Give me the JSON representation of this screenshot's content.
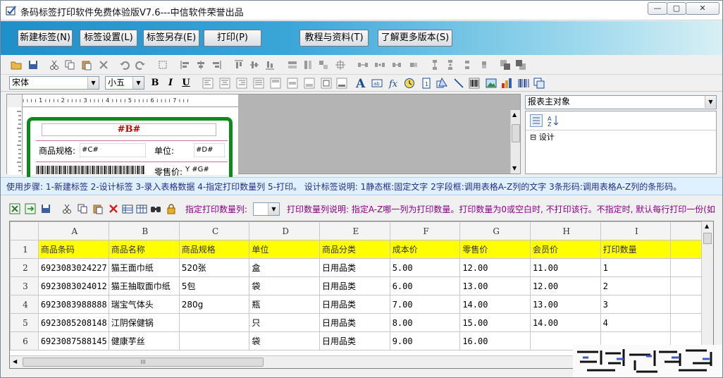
{
  "window": {
    "title": "条码标签打印软件免费体验版V7.6---中信软件荣誉出品",
    "buttons": {
      "minimize": "—",
      "restore": "▢",
      "close": "✕"
    }
  },
  "banner": {
    "buttons": [
      "新建标签(N)",
      "标签设置(L)",
      "标签另存(E)",
      "打印(P)",
      "教程与资料(T)",
      "了解更多版本(S)"
    ]
  },
  "format_bar": {
    "font_name": "宋体",
    "font_size": "小五",
    "bold": "B",
    "italic": "I",
    "underline": "U"
  },
  "designer": {
    "ruler_top": "ı ı ı ı 1 ı ı ı ı 2 ı ı ı ı 3 ı ı ı ı 4 ı ı ı ı 5 ı ı ı ı 6 ı ı ı ı 7 ı ı ı",
    "label": {
      "field_b": "#B#",
      "spec_label": "商品规格:",
      "spec_field": "#C#",
      "unit_label": "单位:",
      "unit_field": "#D#",
      "price_label": "零售价:",
      "price_field": "Y #G#"
    }
  },
  "properties": {
    "object_select": "报表主对象",
    "group_label": "设计"
  },
  "hint": "使用步骤: 1-新建标签 2-设计标签 3-录入表格数据 4-指定打印数量列 5-打印。 设计标签说明: 1静态框:固定文字 2字段框:调用表格A-Z列的文字 3条形码:调用表格A-Z列的条形码。",
  "data_toolbar": {
    "print_qty_label": "指定打印数量列:",
    "print_qty_value": "",
    "explain": "打印数量列说明: 指定A-Z哪一列为打印数量。打印数量为0或空白时, 不打印该行。不指定时, 默认每行打印一份(如"
  },
  "sheet": {
    "columns": [
      "A",
      "B",
      "C",
      "D",
      "E",
      "F",
      "G",
      "H",
      "I"
    ],
    "rows": [
      {
        "n": "1",
        "cells": [
          "商品条码",
          "商品名称",
          "商品规格",
          "单位",
          "商品分类",
          "成本价",
          "零售价",
          "会员价",
          "打印数量"
        ]
      },
      {
        "n": "2",
        "cells": [
          "6923083024227",
          "猫王面巾纸",
          "520张",
          "盒",
          "日用品类",
          "5.00",
          "12.00",
          "11.00",
          "1"
        ]
      },
      {
        "n": "3",
        "cells": [
          "6923083024012",
          "猫王抽取面巾纸",
          "5包",
          "袋",
          "日用品类",
          "6.00",
          "13.00",
          "12.00",
          "2"
        ]
      },
      {
        "n": "4",
        "cells": [
          "6923083988888",
          "瑞宝气体头",
          "280g",
          "瓶",
          "日用品类",
          "7.00",
          "14.00",
          "13.00",
          "3"
        ]
      },
      {
        "n": "5",
        "cells": [
          "6923085208148",
          "江阴保健锅",
          "",
          "只",
          "日用品类",
          "8.00",
          "15.00",
          "14.00",
          "4"
        ]
      },
      {
        "n": "6",
        "cells": [
          "6923087588145",
          "健康芋丝",
          "",
          "袋",
          "日用品类",
          "9.00",
          "16.00",
          "",
          ""
        ]
      }
    ],
    "hscroll_thumb": "III"
  },
  "colors": {
    "banner_start": "#1f8fc8",
    "header_row": "#ffff00",
    "label_frame": "#0e8a1a",
    "label_field": "#cc0000",
    "hint_text": "#2a2a8a",
    "data_toolbar_text": "#8b008b"
  }
}
